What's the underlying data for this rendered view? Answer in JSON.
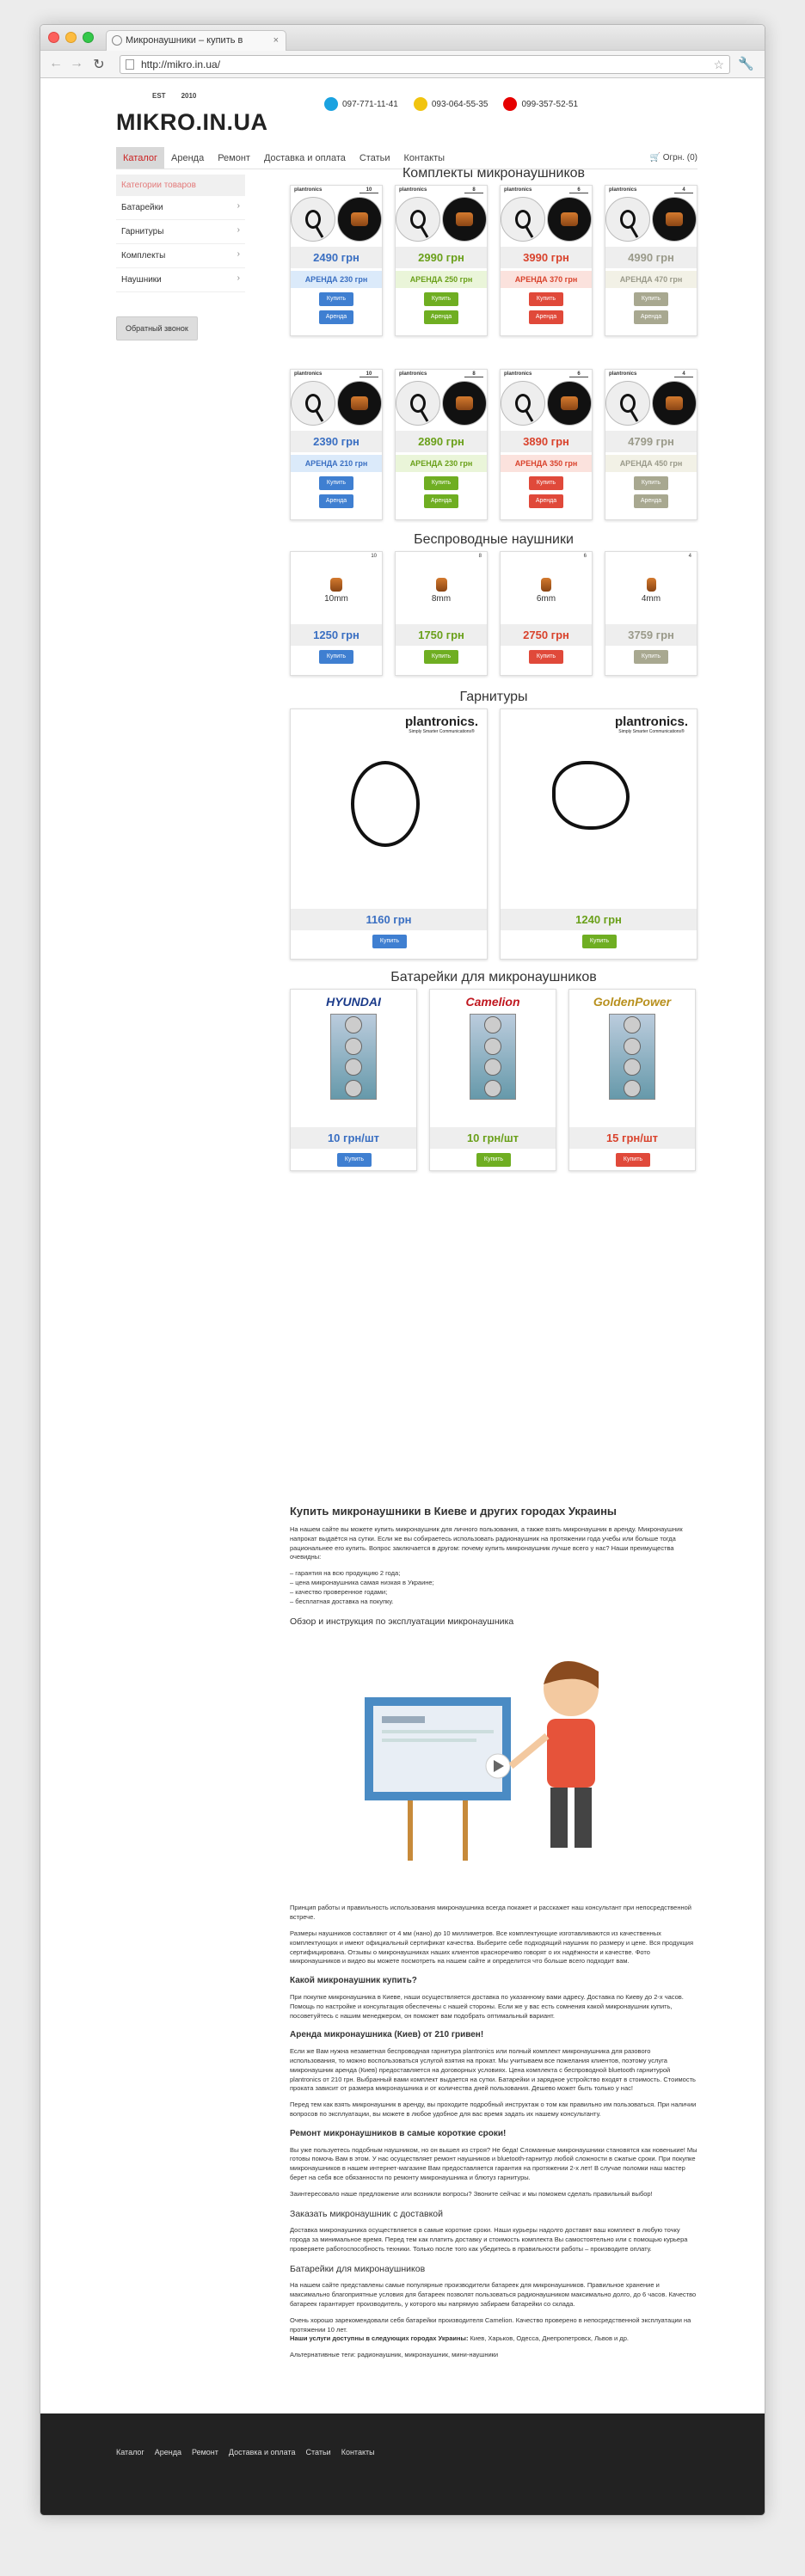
{
  "browser": {
    "tab_title": "Микронаушники – купить в",
    "url": "http://mikro.in.ua/"
  },
  "header": {
    "logo": "MIKRO.IN.UA",
    "est": "EST",
    "year": "2010",
    "phones": [
      {
        "icon": "kyivstar-icon",
        "number": "097-771-11-41",
        "color": "#1aa2e0"
      },
      {
        "icon": "life-icon",
        "number": "093-064-55-35",
        "color": "#f1c40f"
      },
      {
        "icon": "vodafone-icon",
        "number": "099-357-52-51",
        "color": "#e60000"
      }
    ]
  },
  "nav": {
    "items": [
      "Каталог",
      "Аренда",
      "Ремонт",
      "Доставка и оплата",
      "Статьи",
      "Контакты"
    ],
    "cart": "Огрн. (0)"
  },
  "sidebar": {
    "heading": "Категории товаров",
    "items": [
      "Батарейки",
      "Гарнитуры",
      "Комплекты",
      "Наушники"
    ],
    "callback": "Обратный звонок"
  },
  "sections": {
    "kits": "Комплекты микронаушников",
    "wireless": "Беспроводные наушники",
    "headsets": "Гарнитуры",
    "batteries": "Батарейки для микронаушников"
  },
  "kits_row1": [
    {
      "brand": "plantronics",
      "num": "10",
      "price": "2490 грн",
      "rent": "АРЕНДА 230 грн",
      "color": "blue"
    },
    {
      "brand": "plantronics",
      "num": "8",
      "price": "2990 грн",
      "rent": "АРЕНДА 250 грн",
      "color": "green"
    },
    {
      "brand": "plantronics",
      "num": "6",
      "price": "3990 грн",
      "rent": "АРЕНДА 370 грн",
      "color": "red"
    },
    {
      "brand": "plantronics",
      "num": "4",
      "price": "4990 грн",
      "rent": "АРЕНДА 470 грн",
      "color": "gray"
    }
  ],
  "kits_row2": [
    {
      "brand": "plantronics",
      "num": "10",
      "price": "2390 грн",
      "rent": "АРЕНДА 210 грн",
      "color": "blue"
    },
    {
      "brand": "plantronics",
      "num": "8",
      "price": "2890 грн",
      "rent": "АРЕНДА 230 грн",
      "color": "green"
    },
    {
      "brand": "plantronics",
      "num": "6",
      "price": "3890 грн",
      "rent": "АРЕНДА 350 грн",
      "color": "red"
    },
    {
      "brand": "plantronics",
      "num": "4",
      "price": "4799 грн",
      "rent": "АРЕНДА 450 грн",
      "color": "gray"
    }
  ],
  "buy_label": "Купить",
  "rent_label": "Аренда",
  "wireless": [
    {
      "num": "10",
      "size": "10mm",
      "price": "1250 грн",
      "color": "blue"
    },
    {
      "num": "8",
      "size": "8mm",
      "price": "1750 грн",
      "color": "green"
    },
    {
      "num": "6",
      "size": "6mm",
      "price": "2750 грн",
      "color": "red"
    },
    {
      "num": "4",
      "size": "4mm",
      "price": "3759 грн",
      "color": "gray"
    }
  ],
  "headsets": [
    {
      "brand": "plantronics.",
      "tagline": "Simply Smarter Communications®",
      "price": "1160 грн",
      "color": "blue"
    },
    {
      "brand": "plantronics.",
      "tagline": "Simply Smarter Communications®",
      "price": "1240 грн",
      "color": "green"
    }
  ],
  "batteries": [
    {
      "brand": "HYUNDAI",
      "price": "10 грн/шт",
      "color": "blue"
    },
    {
      "brand": "Camelion",
      "price": "10 грн/шт",
      "color": "green"
    },
    {
      "brand": "GoldenPower",
      "price": "15 грн/шт",
      "color": "red"
    }
  ],
  "article": {
    "h1": "Купить микронаушники в Киеве и других городах Украины",
    "p1": "На нашем сайте вы можете купить микронаушник для личного пользования, а также взять микронаушник в аренду. Микронаушник напрокат выдаётся на сутки. Если же вы собираетесь использовать радионаушник на протяжении года учебы или больше тогда рациональнее его купить. Вопрос заключается в другом: почему купить микронаушник лучше всего у нас? Наши преимущества очевидны:",
    "list": [
      "– гарантия на всю продукцию 2 года;",
      "– цена микронаушника самая низкая в Украине;",
      "– качество проверенное годами;",
      "– бесплатная доставка на покупку."
    ],
    "h_video": "Обзор и инструкция по эксплуатации микронаушника",
    "p2": "Принцип работы и правильность использования микронаушника всегда покажет и расскажет наш консультант при непосредственной встрече.",
    "p3": "Размеры наушников составляют от 4 мм (нано) до 10 миллиметров. Все комплектующие изготавливаются из качественных комплектующих и имеют официальный сертификат качества. Выберите себе подходящий наушник по размеру и цене. Вся продукция сертифицирована. Отзывы о микронаушниках наших клиентов красноречиво говорят о их надёжности и качестве. Фото микронаушников и видео вы можете посмотреть на нашем сайте и определится что больше всего подходит вам.",
    "h2": "Какой микронаушник купить?",
    "p4": "При покупке микронаушника в Киеве, наши осуществляется доставка по указанному вами адресу. Доставка по Киеву до 2-х часов. Помощь по настройке и консультация обеспечены с нашей стороны. Если же у вас есть сомнения какой микронаушник купить, посоветуйтесь с нашим менеджером, он поможет вам подобрать оптимальный вариант.",
    "h3": "Аренда микронаушника (Киев) от 210 гривен!",
    "p5": "Если же Вам нужна незаметная беспроводная гарнитура plantronics или полный комплект микронаушника для разового использования, то можно воспользоваться услугой взятия на прокат. Мы учитываем все пожелания клиентов, поэтому услуга микронаушник аренда (Киев) предоставляется на договорных условиях. Цена комплекта с беспроводной bluetooth гарнитурой plantronics от 210 грн. Выбранный вами комплект выдается на сутки. Батарейки и зарядное устройство входят в стоимость. Стоимость проката зависит от размера микронаушника и от количества дней пользования. Дешево может быть только у нас!",
    "p6": "Перед тем как взять микронаушник в аренду, вы проходите подробный инструктаж о том как правильно им пользоваться. При наличии вопросов по эксплуатации, вы можете в любое удобное для вас время задать их нашему консультанту.",
    "h4": "Ремонт микронаушников в самые короткие сроки!",
    "p7": "Вы уже пользуетесь подобным наушником, но он вышел из строя? Не беда! Сломанные микронаушники становятся как новенькие! Мы готовы помочь Вам в этом. У нас осуществляет ремонт наушников и bluetooth-гарнитур любой сложности в сжатые сроки. При покупке микронаушников в нашем интернет-магазине Вам предоставляется гарантия на протяжении 2-х лет! В случае поломки наш мастер берет на себя все обязанности по ремонту микронаушника и блютуз гарнитуры.",
    "p8": "Заинтересовало наше предложение или возникли вопросы? Звоните сейчас и мы поможем сделать правильный выбор!",
    "h5": "Заказать микронаушник с доставкой",
    "p9": "Доставка микронаушника осуществляется в самые короткие сроки. Наши курьеры надолго доставят ваш комплект в любую точку города за минимальное время. Перед тем как платить доставку и стоимость комплекта Вы самостоятельно или с помощью курьера проверяете работоспособность техники. Только после того как убедитесь в правильности работы – производите оплату.",
    "h6": "Батарейки для микронаушников",
    "p10": "На нашем сайте представлены самые популярные производители батареек для микронаушников. Правильное хранение и максимально благоприятные условия для батареек позволят пользоваться радионаушником максимально долго, до 6 часов. Качество батареек гарантирует производитель, у которого мы напрямую забираем батарейки со склада.",
    "p11": "Очень хорошо зарекомендовали себя батарейки производителя Camelion. Качество проверено в непосредственной эксплуатации на протяжении 10 лет.",
    "p12_b": "Наши услуги доступны в следующих городах Украины:",
    "p12": " Киев, Харьков, Одесса, Днепропетровск, Львов и др.",
    "p13": "Альтернативные теги: радионаушник, микронаушник, мини-наушники"
  },
  "footer": {
    "links": [
      "Каталог",
      "Аренда",
      "Ремонт",
      "Доставка и оплата",
      "Статьи",
      "Контакты"
    ]
  }
}
